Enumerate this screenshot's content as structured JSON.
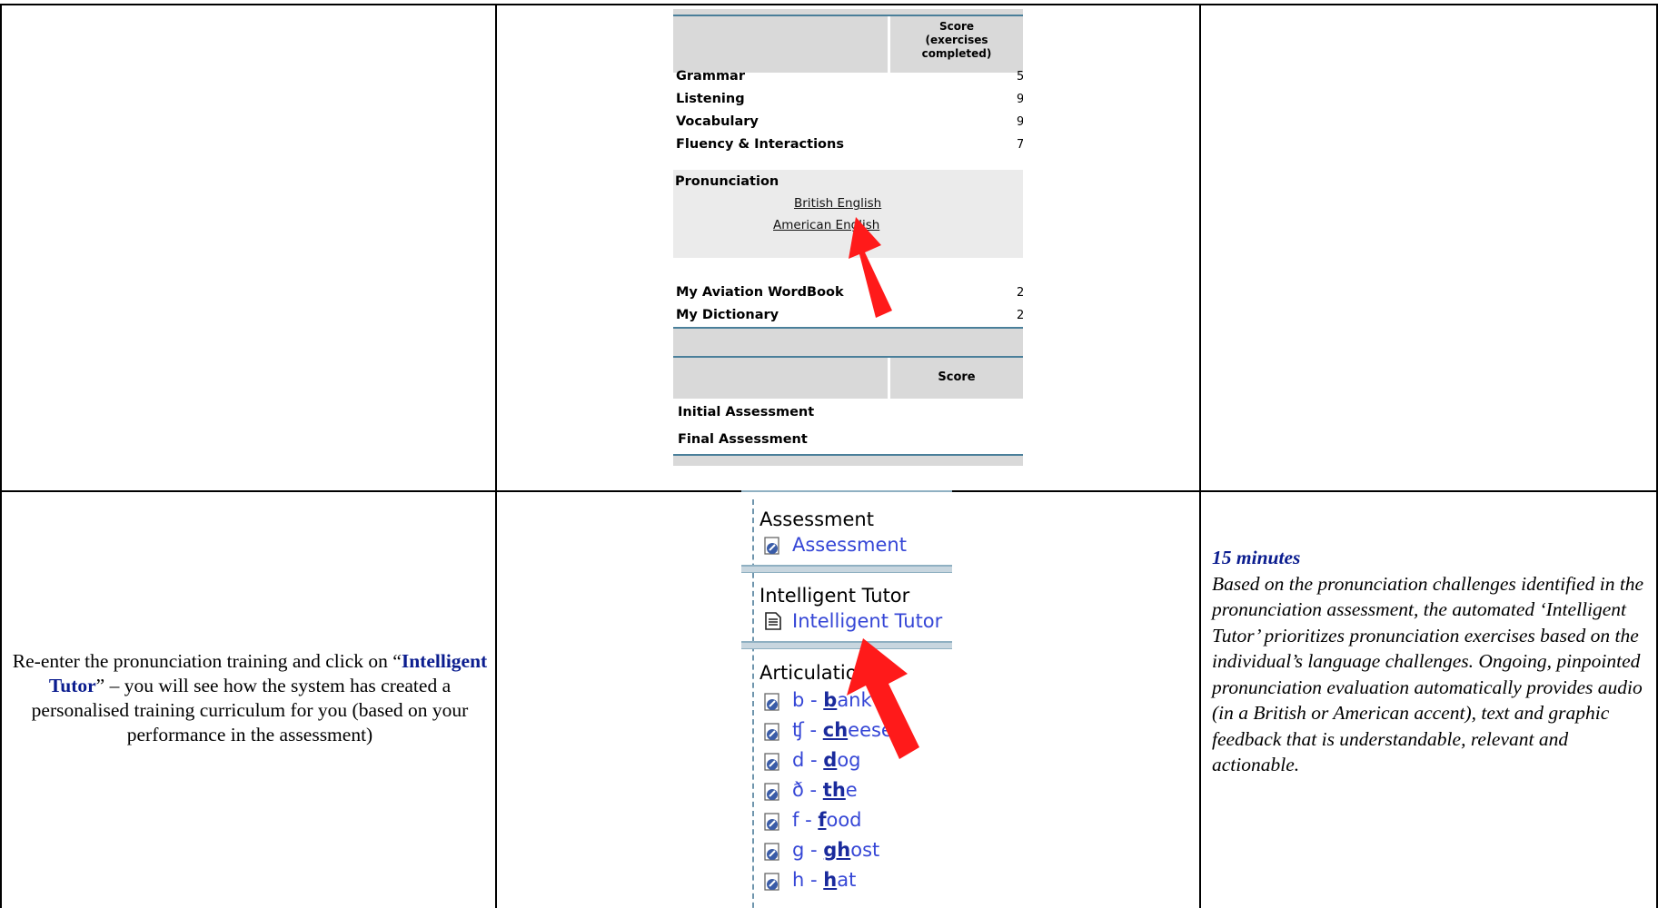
{
  "top_panel": {
    "score_header_1": [
      "Score",
      "(exercises",
      "completed)"
    ],
    "rows": [
      {
        "label": "Grammar",
        "score": "5"
      },
      {
        "label": "Listening",
        "score": "9"
      },
      {
        "label": "Vocabulary",
        "score": "9"
      },
      {
        "label": "Fluency & Interactions",
        "score": "7"
      }
    ],
    "pronunciation": {
      "label": "Pronunciation",
      "links": [
        "British English",
        "American English"
      ]
    },
    "rows2": [
      {
        "label": "My Aviation WordBook",
        "score": "2"
      },
      {
        "label": "My Dictionary",
        "score": "2"
      }
    ],
    "score_header_2": "Score",
    "assessments": [
      "Initial Assessment",
      "Final Assessment"
    ]
  },
  "bottom_panel": {
    "sections": [
      {
        "title": "Assessment",
        "link": "Assessment"
      },
      {
        "title": "Intelligent Tutor",
        "link": "Intelligent Tutor"
      },
      {
        "title": "Articulation"
      }
    ],
    "articulation_items": [
      {
        "sym": "b - ",
        "bold": "b",
        "rest": "ank"
      },
      {
        "sym": "ʧ - ",
        "bold": "ch",
        "rest": "eese"
      },
      {
        "sym": "d - ",
        "bold": "d",
        "rest": "og"
      },
      {
        "sym": "ð - ",
        "bold": "th",
        "rest": "e"
      },
      {
        "sym": "f - ",
        "bold": "f",
        "rest": "ood"
      },
      {
        "sym": "g - ",
        "bold": "gh",
        "rest": "ost"
      },
      {
        "sym": "h - ",
        "bold": "h",
        "rest": "at"
      }
    ]
  },
  "instruction": {
    "before": "Re-enter the pronunciation training and click on “",
    "highlight": "Intelligent Tutor",
    "after": "” – you will see how the system has created a personalised training curriculum for you (based on your performance in the assessment)"
  },
  "description": {
    "duration": "15 minutes",
    "body": "Based on the pronunciation challenges identified in the pronunciation assessment, the automated ‘Intelligent Tutor’ prioritizes pronunciation exercises based on the individual’s language challenges. Ongoing, pinpointed pronunciation evaluation automatically provides audio (in a British or American accent), text and graphic feedback that is understandable, relevant and actionable."
  },
  "colors": {
    "arrow": "#ff1a1a",
    "highlight": "#0b1d8f",
    "link": "#3546d6"
  }
}
